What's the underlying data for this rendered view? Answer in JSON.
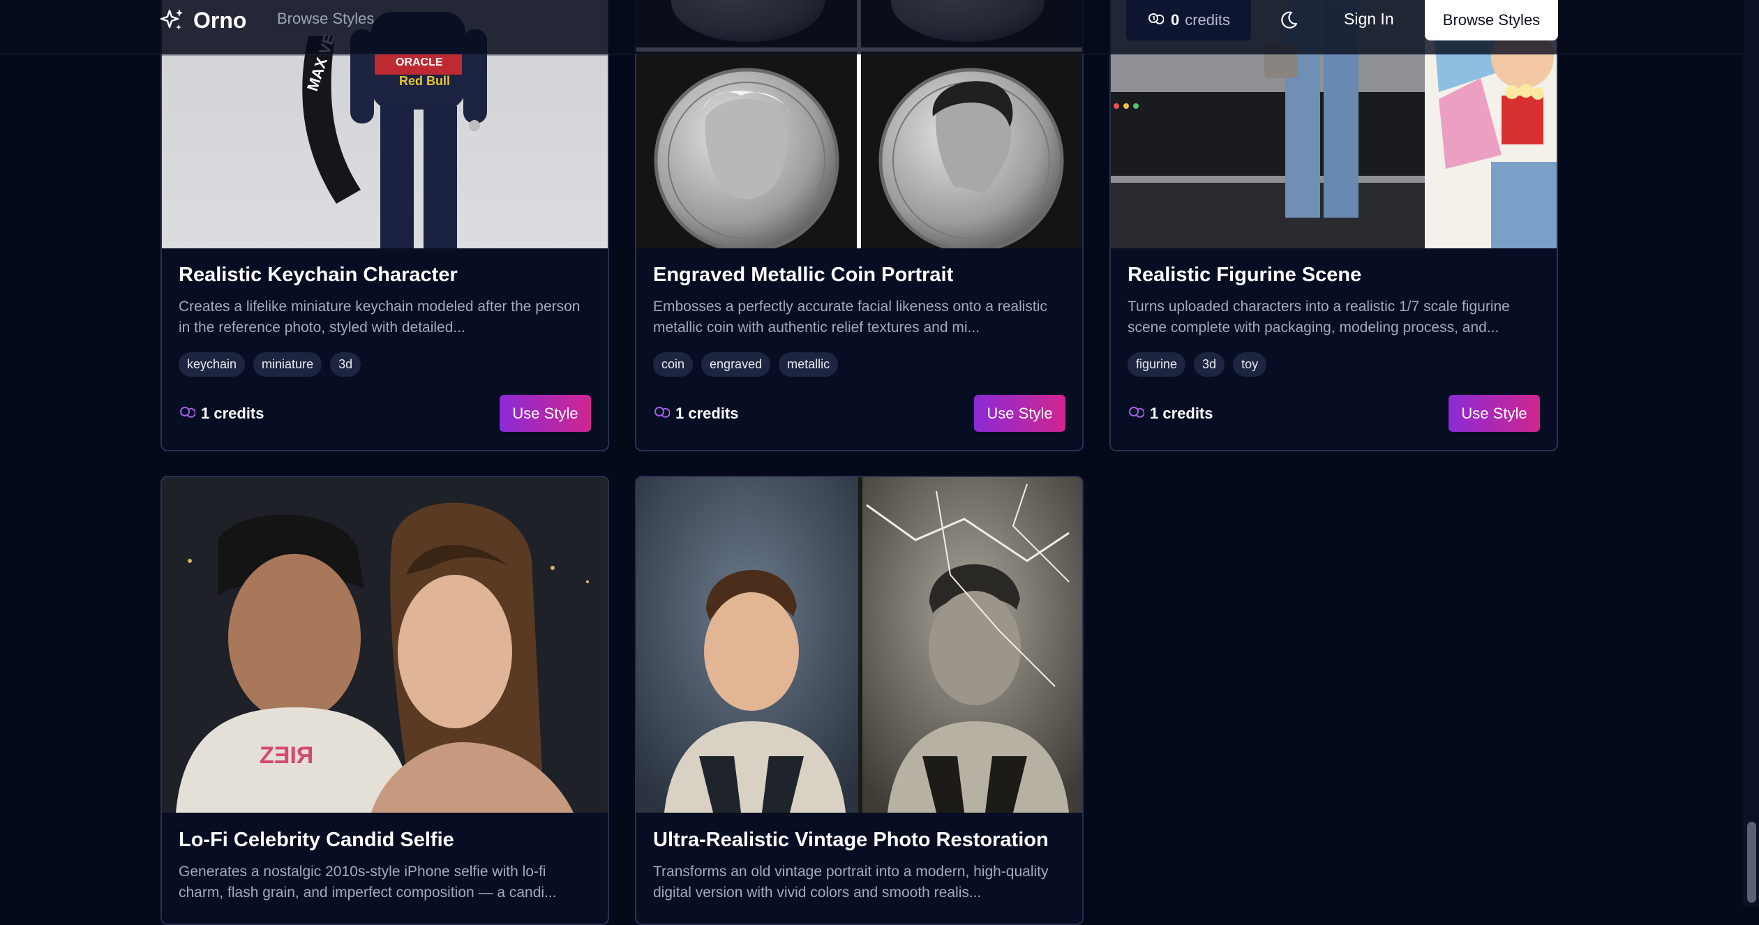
{
  "header": {
    "logo_text": "Orno",
    "nav_browse": "Browse Styles",
    "credits_count": "0",
    "credits_label": "credits",
    "sign_in": "Sign In",
    "browse_button": "Browse Styles"
  },
  "cards": [
    {
      "title": "Realistic Keychain Character",
      "description": "Creates a lifelike miniature keychain modeled after the person in the reference photo, styled with detailed...",
      "tags": [
        "keychain",
        "miniature",
        "3d"
      ],
      "cost": "1 credits",
      "button": "Use Style"
    },
    {
      "title": "Engraved Metallic Coin Portrait",
      "description": "Embosses a perfectly accurate facial likeness onto a realistic metallic coin with authentic relief textures and mi...",
      "tags": [
        "coin",
        "engraved",
        "metallic"
      ],
      "cost": "1 credits",
      "button": "Use Style"
    },
    {
      "title": "Realistic Figurine Scene",
      "description": "Turns uploaded characters into a realistic 1/7 scale figurine scene complete with packaging, modeling process, and...",
      "tags": [
        "figurine",
        "3d",
        "toy"
      ],
      "cost": "1 credits",
      "button": "Use Style"
    },
    {
      "title": "Lo-Fi Celebrity Candid Selfie",
      "description": "Generates a nostalgic 2010s-style iPhone selfie with lo-fi charm, flash grain, and imperfect composition — a candi...",
      "tags": [],
      "cost": "",
      "button": ""
    },
    {
      "title": "Ultra-Realistic Vintage Photo Restoration",
      "description": "Transforms an old vintage portrait into a modern, high-quality digital version with vivid colors and smooth realis...",
      "tags": [],
      "cost": "",
      "button": ""
    }
  ]
}
